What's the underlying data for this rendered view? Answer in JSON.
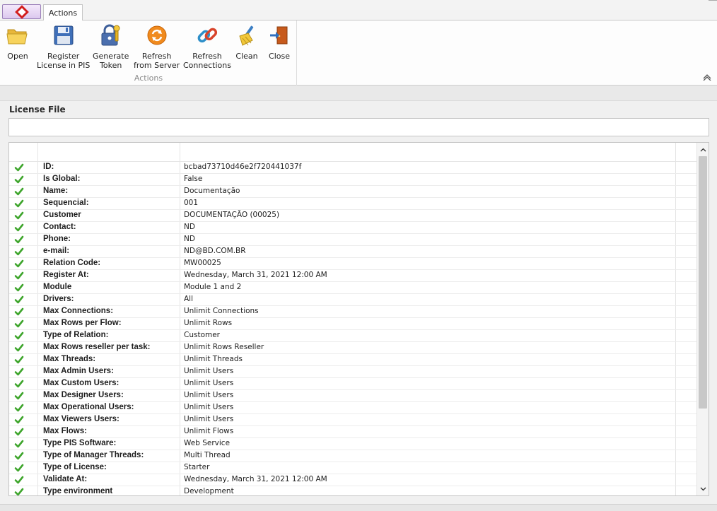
{
  "tabs": {
    "active": "Actions"
  },
  "ribbon": {
    "group_label": "Actions",
    "buttons": [
      {
        "label": "Open",
        "icon": "folder-open-icon"
      },
      {
        "label": "Register\nLicense in PIS",
        "icon": "floppy-disk-icon"
      },
      {
        "label": "Generate\nToken",
        "icon": "padlock-key-icon"
      },
      {
        "label": "Refresh\nfrom Server",
        "icon": "orange-refresh-icon"
      },
      {
        "label": "Refresh\nConnections",
        "icon": "chain-link-icon"
      },
      {
        "label": "Clean",
        "icon": "broom-icon"
      },
      {
        "label": "Close",
        "icon": "exit-door-icon"
      }
    ]
  },
  "license": {
    "title": "License File",
    "file_value": "",
    "rows": [
      {
        "key": "ID:",
        "value": "bcbad73710d46e2f720441037f"
      },
      {
        "key": "Is Global:",
        "value": "False"
      },
      {
        "key": "Name:",
        "value": "Documentação"
      },
      {
        "key": "Sequencial:",
        "value": "001"
      },
      {
        "key": "Customer",
        "value": "DOCUMENTAÇÃO (00025)"
      },
      {
        "key": "Contact:",
        "value": "ND"
      },
      {
        "key": "Phone:",
        "value": "ND"
      },
      {
        "key": "e-mail:",
        "value": "ND@BD.COM.BR"
      },
      {
        "key": "Relation Code:",
        "value": "MW00025"
      },
      {
        "key": "Register At:",
        "value": "Wednesday, March 31, 2021 12:00 AM"
      },
      {
        "key": "Module",
        "value": "Module 1 and 2"
      },
      {
        "key": "Drivers:",
        "value": "All"
      },
      {
        "key": "Max Connections:",
        "value": "Unlimit Connections"
      },
      {
        "key": "Max Rows per Flow:",
        "value": "Unlimit Rows"
      },
      {
        "key": "Type of Relation:",
        "value": "Customer"
      },
      {
        "key": "Max Rows reseller per task:",
        "value": "Unlimit Rows Reseller"
      },
      {
        "key": "Max Threads:",
        "value": "Unlimit Threads"
      },
      {
        "key": "Max Admin Users:",
        "value": "Unlimit Users"
      },
      {
        "key": "Max Custom Users:",
        "value": "Unlimit Users"
      },
      {
        "key": "Max Designer Users:",
        "value": "Unlimit Users"
      },
      {
        "key": "Max Operational Users:",
        "value": "Unlimit Users"
      },
      {
        "key": "Max Viewers Users:",
        "value": "Unlimit Users"
      },
      {
        "key": "Max Flows:",
        "value": "Unlimit Flows"
      },
      {
        "key": "Type PIS Software:",
        "value": "Web Service"
      },
      {
        "key": "Type of Manager Threads:",
        "value": "Multi Thread"
      },
      {
        "key": "Type of License:",
        "value": "Starter"
      },
      {
        "key": "Validate At:",
        "value": "Wednesday, March 31, 2021 12:00 AM"
      },
      {
        "key": "Type environment",
        "value": "Development"
      }
    ]
  },
  "colors": {
    "check": "#3ea52c",
    "accent": "#d21f1f"
  }
}
